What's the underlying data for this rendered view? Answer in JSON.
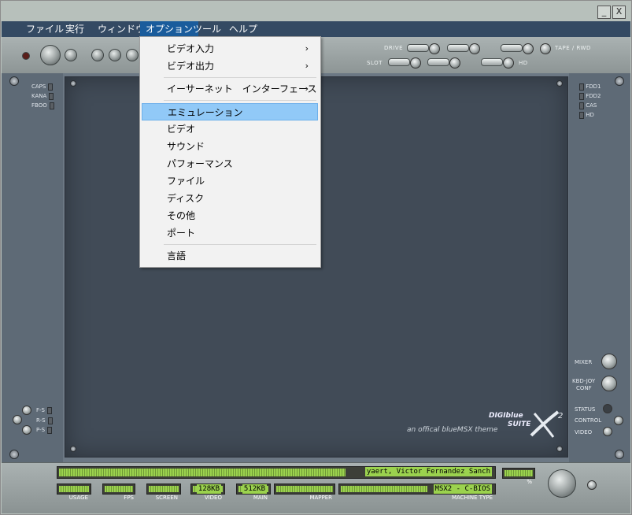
{
  "window": {
    "minimize_label": "_",
    "close_label": "X"
  },
  "menubar": {
    "items": [
      {
        "label": "ファイル"
      },
      {
        "label": "実行"
      },
      {
        "label": "ウィンドウ"
      },
      {
        "label": "オプション"
      },
      {
        "label": "ツール"
      },
      {
        "label": "ヘルプ"
      }
    ]
  },
  "toolbar": {
    "drive_label": "DRIVE",
    "slot_label": "SLOT",
    "tape_label": "TAPE / RWD",
    "hd_label": "HD"
  },
  "left_leds": [
    {
      "label": "CAPS"
    },
    {
      "label": "KANA"
    },
    {
      "label": "FBOO"
    }
  ],
  "right_leds": [
    {
      "label": "FDD1"
    },
    {
      "label": "FDD2"
    },
    {
      "label": "CAS"
    },
    {
      "label": "HD"
    }
  ],
  "left_controls": [
    {
      "label": "F-S"
    },
    {
      "label": "R-S"
    },
    {
      "label": "P-S"
    }
  ],
  "right_controls": {
    "mixer": "MIXER",
    "kbd_joy_1": "KBD-JOY",
    "kbd_joy_2": "CONF",
    "status": "STATUS",
    "control": "CONTROL",
    "video": "VIDEO"
  },
  "logo": {
    "brand": "DIGIblue",
    "suite": "SUITE",
    "tagline": "an offical blueMSX theme"
  },
  "status": {
    "message": "yaert, Victor Fernandez Sanch",
    "usage_label": "USAGE",
    "fps_label": "FPS",
    "screen_label": "SCREEN",
    "video_label": "VIDEO",
    "video_value": "128KB",
    "main_label": "MAIN",
    "main_value": "512KB",
    "mapper_label": "MAPPER",
    "machine_label": "MACHINE TYPE",
    "machine_value": "MSX2 - C-BIOS",
    "percent_label": "%"
  },
  "dropdown": {
    "items": [
      {
        "label": "ビデオ入力",
        "submenu": "›"
      },
      {
        "label": "ビデオ出力",
        "submenu": "›"
      },
      {
        "label": "イーサーネット　インターフェース",
        "submenu": "›"
      },
      {
        "label": "エミュレーション"
      },
      {
        "label": "ビデオ"
      },
      {
        "label": "サウンド"
      },
      {
        "label": "パフォーマンス"
      },
      {
        "label": "ファイル"
      },
      {
        "label": "ディスク"
      },
      {
        "label": "その他"
      },
      {
        "label": "ポート"
      },
      {
        "label": "言語"
      }
    ]
  }
}
